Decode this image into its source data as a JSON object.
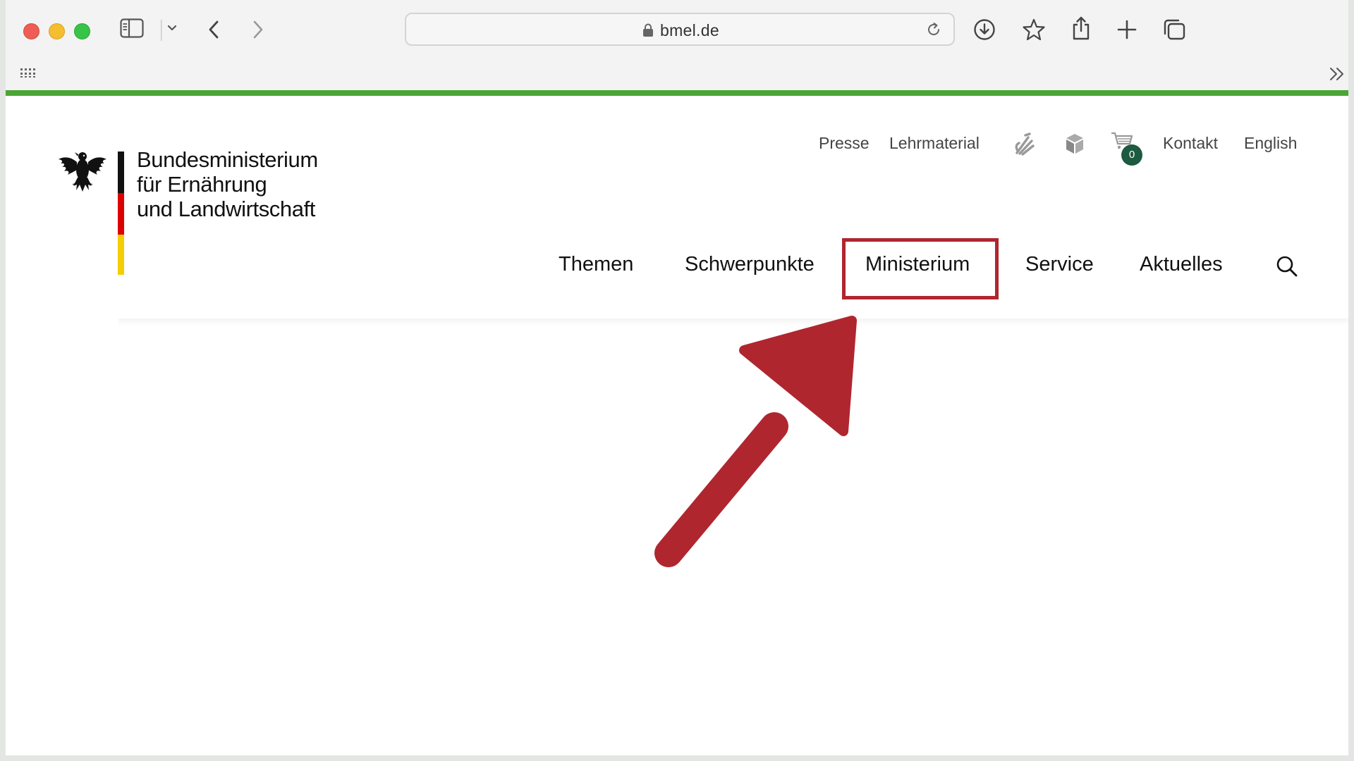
{
  "browser": {
    "url": "bmel.de",
    "extensions_icon": "apps-grid-icon",
    "overflow_icon": "double-chevron-icon"
  },
  "site": {
    "ministry_name_lines": [
      "Bundesministerium",
      "für Ernährung",
      "und Landwirtschaft"
    ],
    "meta_nav": {
      "press": "Presse",
      "teaching_material": "Lehrmaterial",
      "sign_language_icon": "sign-language-icon",
      "easy_language_icon": "easy-language-icon",
      "cart_count": "0",
      "contact": "Kontakt",
      "english": "English"
    },
    "main_nav": {
      "themes": "Themen",
      "focus": "Schwerpunkte",
      "ministry": "Ministerium",
      "service": "Service",
      "news": "Aktuelles"
    }
  },
  "annotation": {
    "highlight_color": "#b0262f",
    "arrow_color": "#b0262f",
    "target": "Ministerium"
  },
  "colors": {
    "accent_green": "#4aa534",
    "flag_black": "#111111",
    "flag_red": "#dd0000",
    "flag_gold": "#f6cd00",
    "badge_green": "#1d5a3f"
  }
}
